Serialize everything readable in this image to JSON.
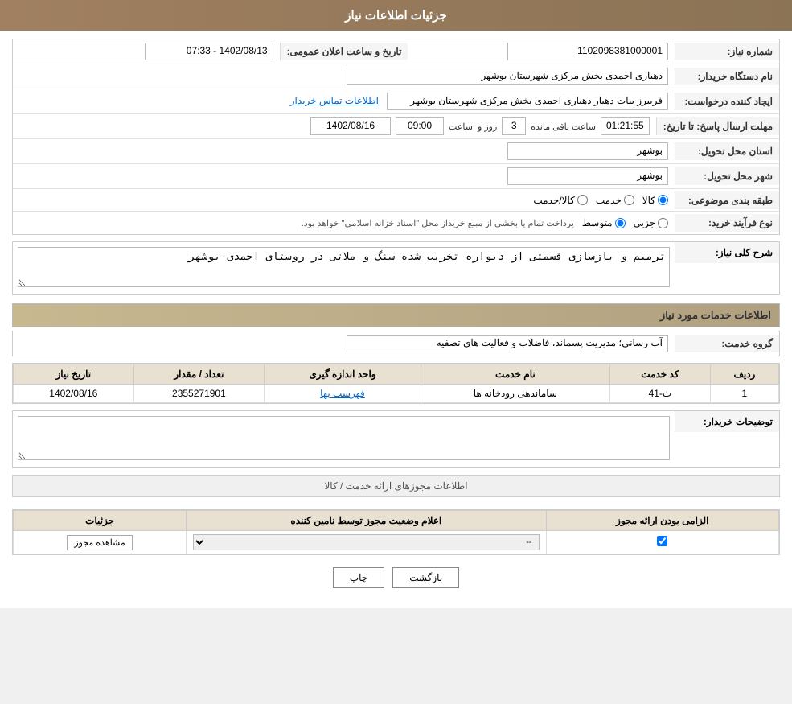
{
  "page": {
    "title": "جزئیات اطلاعات نیاز"
  },
  "header": {
    "shomara_niaz_label": "شماره نیاز:",
    "shomara_niaz_value": "1102098381000001",
    "tarikh_label": "تاریخ و ساعت اعلان عمومی:",
    "tarikh_value": "1402/08/13 - 07:33",
    "name_dastgah_label": "نام دستگاه خریدار:",
    "name_dastgah_value": "دهیاری احمدی بخش مرکزی شهرستان بوشهر",
    "ijad_konande_label": "ایجاد کننده درخواست:",
    "ijad_konande_value": "فریبرز بیات دهیار دهیاری احمدی بخش مرکزی شهرستان بوشهر",
    "ettelaat_tamas_label": "اطلاعات تماس خریدار",
    "mohlat_ersal_label": "مهلت ارسال پاسخ: تا تاریخ:",
    "mohlat_ersal_date": "1402/08/16",
    "mohlat_ersal_time_label": "ساعت",
    "mohlat_ersal_time": "09:00",
    "mohlat_ersal_roz": "3",
    "mohlat_ersal_roz_label": "روز و",
    "mohlat_ersal_baqi": "01:21:55",
    "mohlat_ersal_baqi_label": "ساعت باقی مانده",
    "ostan_label": "استان محل تحویل:",
    "ostan_value": "بوشهر",
    "shahr_label": "شهر محل تحویل:",
    "shahr_value": "بوشهر",
    "tabaqe_label": "طبقه بندی موضوعی:",
    "tabaqe_kala": "کالا",
    "tabaqe_khadamat": "خدمت",
    "tabaqe_kala_khadamat": "کالا/خدمت",
    "noè_farayand_label": "نوع فرآیند خرید:",
    "noè_farayand_jozii": "جزیی",
    "noè_farayand_motevaset": "متوسط",
    "noè_farayand_desc": "پرداخت تمام یا بخشی از مبلغ خریداز محل \"اسناد خزانه اسلامی\" خواهد بود."
  },
  "sharh_koli": {
    "label": "شرح کلی نیاز:",
    "value": "ترمیم و بازسازی قسمتی از دیواره تخریب شده سنگ و ملاتی در روستای احمدی-بوشهر"
  },
  "services_section": {
    "title": "اطلاعات خدمات مورد نیاز",
    "group_label": "گروه خدمت:",
    "group_value": "آب رسانی؛ مدیریت پسماند، فاضلاب و فعالیت های تصفیه",
    "table": {
      "headers": [
        "ردیف",
        "کد خدمت",
        "نام خدمت",
        "واحد اندازه گیری",
        "تعداد / مقدار",
        "تاریخ نیاز"
      ],
      "rows": [
        {
          "radif": "1",
          "kod_khadamat": "ث-41",
          "name_khadamat": "ساماندهی رودخانه ها",
          "vahad": "فهرست بها",
          "tedad": "2355271901",
          "tarikh": "1402/08/16"
        }
      ]
    }
  },
  "tawzihaat": {
    "label": "توضیحات خریدار:",
    "value": ""
  },
  "permit_section": {
    "title": "اطلاعات مجوزهای ارائه خدمت / کالا",
    "table": {
      "headers": [
        "الزامی بودن ارائه مجوز",
        "اعلام وضعیت مجوز توسط نامین کننده",
        "جزئیات"
      ],
      "rows": [
        {
          "elzami": true,
          "alam_vaziat": "--",
          "joziyat_btn": "مشاهده مجوز"
        }
      ]
    }
  },
  "buttons": {
    "print": "چاپ",
    "back": "بازگشت"
  }
}
